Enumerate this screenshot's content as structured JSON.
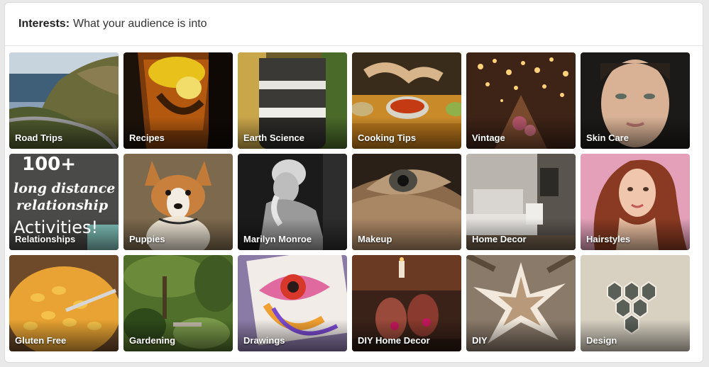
{
  "header": {
    "title_bold": "Interests:",
    "title_rest": "What your audience is into"
  },
  "tiles": [
    {
      "label": "Road Trips",
      "icon": "road-trip-photo"
    },
    {
      "label": "Recipes",
      "icon": "cocktail-photo"
    },
    {
      "label": "Earth Science",
      "icon": "layered-jar-photo"
    },
    {
      "label": "Cooking Tips",
      "icon": "cooking-bowls-photo"
    },
    {
      "label": "Vintage",
      "icon": "vintage-lights-photo"
    },
    {
      "label": "Skin Care",
      "icon": "face-portrait-photo"
    },
    {
      "label": "Relationships",
      "icon": "text-poster-image",
      "poster": {
        "number": "100+",
        "line1": "long distance",
        "line2": "relationship",
        "line3": "Activities!"
      }
    },
    {
      "label": "Puppies",
      "icon": "corgi-puppy-photo"
    },
    {
      "label": "Marilyn Monroe",
      "icon": "bw-portrait-photo"
    },
    {
      "label": "Makeup",
      "icon": "eye-makeup-photo"
    },
    {
      "label": "Home Decor",
      "icon": "bedroom-photo"
    },
    {
      "label": "Hairstyles",
      "icon": "redhead-portrait-photo"
    },
    {
      "label": "Gluten Free",
      "icon": "mac-and-cheese-photo"
    },
    {
      "label": "Gardening",
      "icon": "garden-photo"
    },
    {
      "label": "Drawings",
      "icon": "eye-drawing-photo"
    },
    {
      "label": "DIY Home Decor",
      "icon": "candle-glasses-photo"
    },
    {
      "label": "DIY",
      "icon": "stick-star-photo"
    },
    {
      "label": "Design",
      "icon": "hexagon-collage-photo"
    }
  ]
}
